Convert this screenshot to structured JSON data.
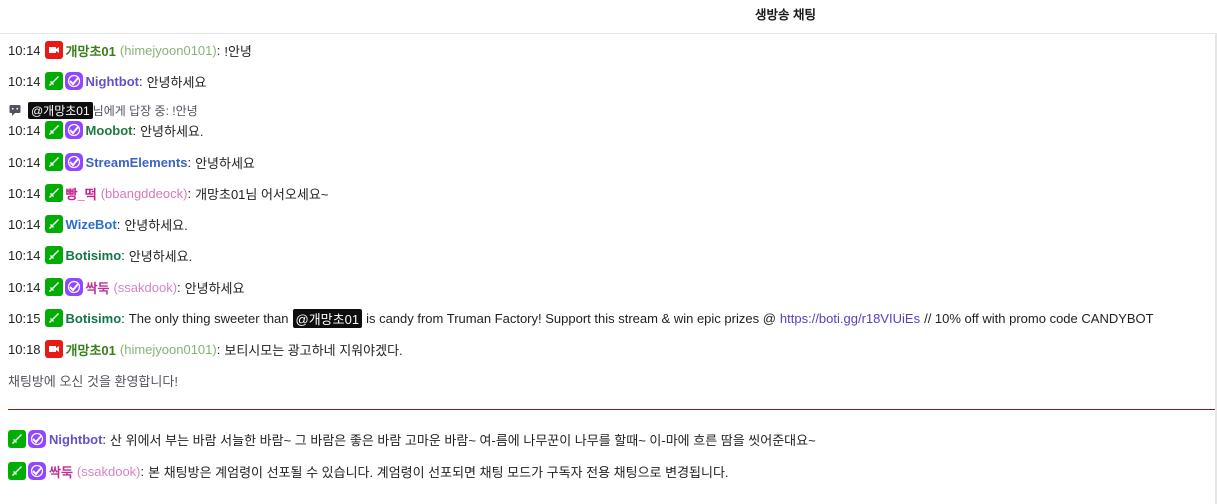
{
  "header": {
    "title": "생방송 채팅"
  },
  "colors": {
    "broadcaster_badge": "#e91916",
    "moderator_badge": "#00ad03",
    "verified_badge": "#9146ff",
    "divider": "#8b1c1c",
    "link": "#5c3ec2"
  },
  "messages": [
    {
      "time": "10:14",
      "user": "개망초01",
      "login": "(himejyoon0101)",
      "text": "!안녕",
      "color": "#3a7d1b"
    },
    {
      "time": "10:14",
      "user": "Nightbot",
      "text": "안녕하세요",
      "color": "#6550c9"
    },
    {
      "time": "10:14",
      "user": "Moobot",
      "text": "안녕하세요.",
      "color": "#1e7a3d"
    },
    {
      "time": "10:14",
      "user": "StreamElements",
      "text": "안녕하세요",
      "color": "#3a63c9"
    },
    {
      "time": "10:14",
      "user": "빵_떡",
      "login": "(bbangddeock)",
      "text": "개망초01님 어서오세요~",
      "color": "#c21d8b"
    },
    {
      "time": "10:14",
      "user": "WizeBot",
      "text": "안녕하세요.",
      "color": "#2a6fcf"
    },
    {
      "time": "10:14",
      "user": "Botisimo",
      "text": "안녕하세요.",
      "color": "#15744a"
    },
    {
      "time": "10:14",
      "user": "싹둑",
      "login": "(ssakdook)",
      "text": "안녕하세요",
      "color": "#b9319a"
    },
    {
      "time": "10:15",
      "user": "Botisimo",
      "color": "#15744a",
      "text_before": "The only thing sweeter than",
      "mention": "@개망초01",
      "text_middle": "is candy from Truman Factory! Support this stream & win epic prizes @",
      "link": "https://boti.gg/r18VIUiEs",
      "text_after": "// 10% off with promo code CANDYBOT"
    },
    {
      "time": "10:18",
      "user": "개망초01",
      "login": "(himejyoon0101)",
      "text": "보티시모는 광고하네 지워야겠다.",
      "color": "#3a7d1b"
    }
  ],
  "reply": {
    "mention": "@개망초01",
    "suffix": "님에게 답장 중: !안녕"
  },
  "welcome": "채팅방에 오신 것을 환영합니다!",
  "pinned": [
    {
      "user": "Nightbot",
      "text": "산 위에서 부는 바람 서늘한 바람~ 그 바람은 좋은 바람 고마운 바람~ 여-름에 나무꾼이 나무를 할때~ 이-마에 흐른 땀을 씻어준대요~",
      "color": "#6550c9"
    },
    {
      "user": "싹둑",
      "login": "(ssakdook)",
      "text": "본 채팅방은 계엄령이 선포될 수 있습니다. 계엄령이 선포되면 채팅 모드가 구독자 전용 채팅으로 변경됩니다.",
      "color": "#b9319a"
    }
  ]
}
